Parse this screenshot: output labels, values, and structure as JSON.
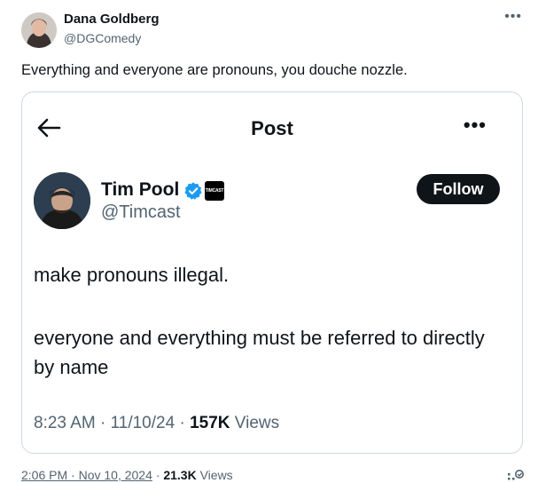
{
  "tweet": {
    "author_name": "Dana Goldberg",
    "author_handle": "@DGComedy",
    "more_icon": "more-icon",
    "text": "Everything and everyone are pronouns, you douche nozzle.",
    "time": "2:06 PM",
    "date": "Nov 10, 2024",
    "views_count": "21.3K",
    "views_label": "Views",
    "separator": "·"
  },
  "quote": {
    "header_title": "Post",
    "back_icon": "back-arrow-icon",
    "more_icon": "more-icon",
    "author_name": "Tim Pool",
    "author_handle": "@Timcast",
    "verified_icon": "verified-badge-icon",
    "affiliate_badge": "TIMCAST",
    "follow_label": "Follow",
    "text_line1": "make pronouns illegal.",
    "text_line2": "everyone and everything must be referred to directly by name",
    "time": "8:23 AM",
    "date": "11/10/24",
    "views_count": "157K",
    "views_label": "Views",
    "separator": "·"
  },
  "colors": {
    "text": "#0f1419",
    "secondary": "#536471",
    "border": "#cfd9de",
    "verified": "#1d9bf0"
  }
}
